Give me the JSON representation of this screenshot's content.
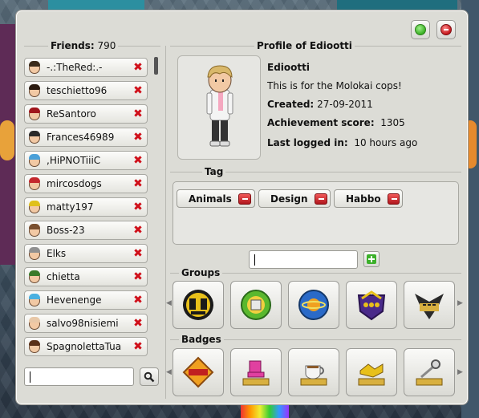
{
  "window": {
    "friends": {
      "label": "Friends:",
      "count": "790"
    },
    "profile_header": "Profile of Ediootti",
    "minimize_icon": "green-circle-icon",
    "close_icon": "close-icon"
  },
  "friends": [
    {
      "name": "-.:TheRed:.-",
      "hair": "#3a2a1a"
    },
    {
      "name": "teschietto96",
      "hair": "#2b1a10"
    },
    {
      "name": "ReSantoro",
      "hair": "#a0161c"
    },
    {
      "name": "Frances46989",
      "hair": "#2a2a2a"
    },
    {
      "name": ",HiPNOTiiiC",
      "hair": "#4aa0d8"
    },
    {
      "name": "mircosdogs",
      "hair": "#c4282e"
    },
    {
      "name": "matty197",
      "hair": "#e0c01a"
    },
    {
      "name": "Boss-23",
      "hair": "#7a5030"
    },
    {
      "name": "Elks",
      "hair": "#909090"
    },
    {
      "name": "chietta",
      "hair": "#3a7a2a"
    },
    {
      "name": "Hevenenge",
      "hair": "#4ab0e0"
    },
    {
      "name": "salvo98nisiemi",
      "hair": "#e8c8a8"
    },
    {
      "name": "SpagnolettaTua",
      "hair": "#5a3018"
    }
  ],
  "profile": {
    "name": "Ediootti",
    "motto": "This is for the Molokai cops!",
    "created_label": "Created:",
    "created_value": "27-09-2011",
    "achievement_label": "Achievement score:",
    "achievement_value": "1305",
    "last_label": "Last logged in:",
    "last_value": "10 hours ago"
  },
  "tags": {
    "header": "Tag",
    "items": [
      "Animals",
      "Design",
      "Habbo"
    ]
  },
  "groups": {
    "header": "Groups"
  },
  "badges": {
    "header": "Badges"
  }
}
